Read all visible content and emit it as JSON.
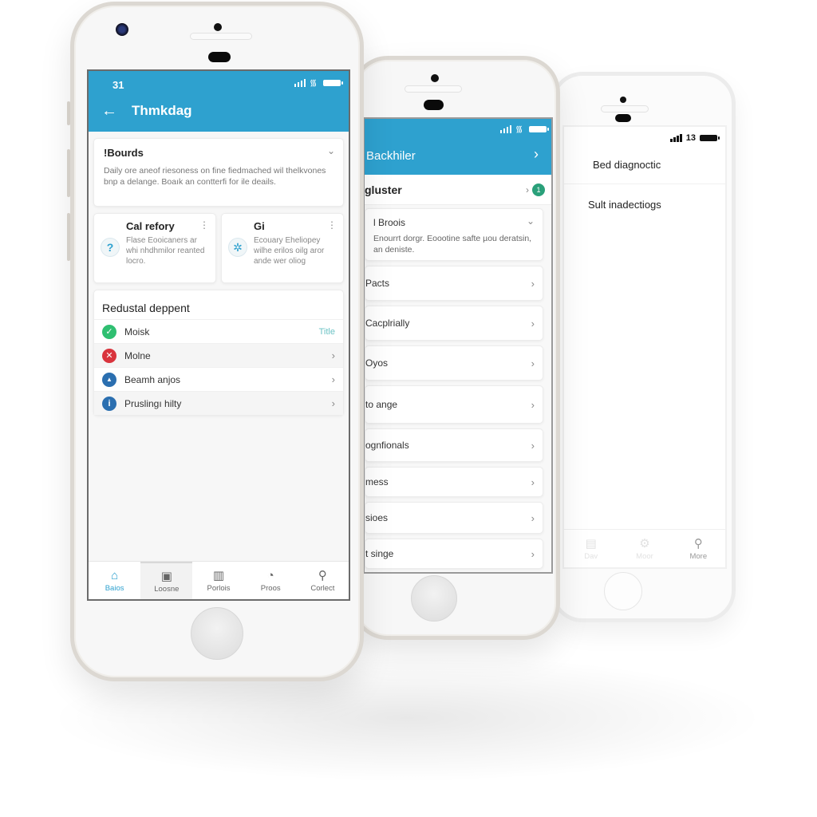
{
  "phone_front": {
    "status_time": "31",
    "header_title": "Thmkdag",
    "accordion": {
      "title": "!Bourds",
      "body": "Daily ore aneof riesoness on fine fiedmached wil thelkvones bnp a delange. Boaık an contterfi for ile deails."
    },
    "mini_cards": [
      {
        "title": "Cal refory",
        "icon": "help-question-icon",
        "glyph": "?",
        "body": "Flase Eooicaners ar whi nhdhmilor reanted locro."
      },
      {
        "title": "Gi",
        "icon": "network-icon",
        "glyph": "✲",
        "body": "Ecouary Eheliopey wilhe erilos oilg aror ande wer oliog"
      }
    ],
    "list": {
      "title": "Redustal deppent",
      "rows": [
        {
          "label": "Moisk",
          "icon": "check-circle-icon",
          "glyph": "✓",
          "color": "#2fbf71",
          "trailing": "Title",
          "trailing_type": "link"
        },
        {
          "label": "Molne",
          "icon": "error-x-icon",
          "glyph": "✕",
          "color": "#d9343d",
          "trailing": "›",
          "trailing_type": "chevron"
        },
        {
          "label": "Beamh anjos",
          "icon": "lock-circle-icon",
          "glyph": "▲",
          "color": "#2b6fb0",
          "trailing": "›",
          "trailing_type": "chevron"
        },
        {
          "label": "Pruslingı hilty",
          "icon": "info-circle-icon",
          "glyph": "i",
          "color": "#2b6fb0",
          "trailing": "›",
          "trailing_type": "chevron"
        }
      ]
    },
    "tabs": [
      {
        "label": "Baios",
        "icon": "home-icon",
        "glyph": "⌂",
        "state": "active"
      },
      {
        "label": "Loosne",
        "icon": "computer-icon",
        "glyph": "▣",
        "state": "pressed"
      },
      {
        "label": "Porlois",
        "icon": "calendar-icon",
        "glyph": "▥",
        "state": ""
      },
      {
        "label": "Proos",
        "icon": "clock-icon",
        "glyph": "◔",
        "state": ""
      },
      {
        "label": "Corlect",
        "icon": "search-icon",
        "glyph": "⚲",
        "state": ""
      }
    ]
  },
  "phone_middle": {
    "header_title": "Backhiler",
    "register": {
      "label": "gluster",
      "badge": "1"
    },
    "accordion": {
      "title": "l Broois",
      "body": "Enourrt dorgr. Eoootine safte µou deratsin, an deniste."
    },
    "items": [
      "Pacts",
      "Cacplrially",
      "Oyos",
      "to ange",
      "ognfionals",
      "mess",
      "sioes",
      "t singe"
    ]
  },
  "phone_back": {
    "status_text": "13",
    "rows": [
      "Bed diagnoctic",
      "Sult inadectiogs"
    ],
    "tabs": [
      {
        "label": "Dav",
        "icon": "document-icon"
      },
      {
        "label": "Moor",
        "icon": "settings-icon"
      },
      {
        "label": "More",
        "icon": "people-search-icon"
      }
    ]
  },
  "colors": {
    "accent": "#2ea1cf",
    "success": "#2fbf71",
    "danger": "#d9343d",
    "info": "#2b6fb0",
    "badge": "#2aa07a"
  }
}
